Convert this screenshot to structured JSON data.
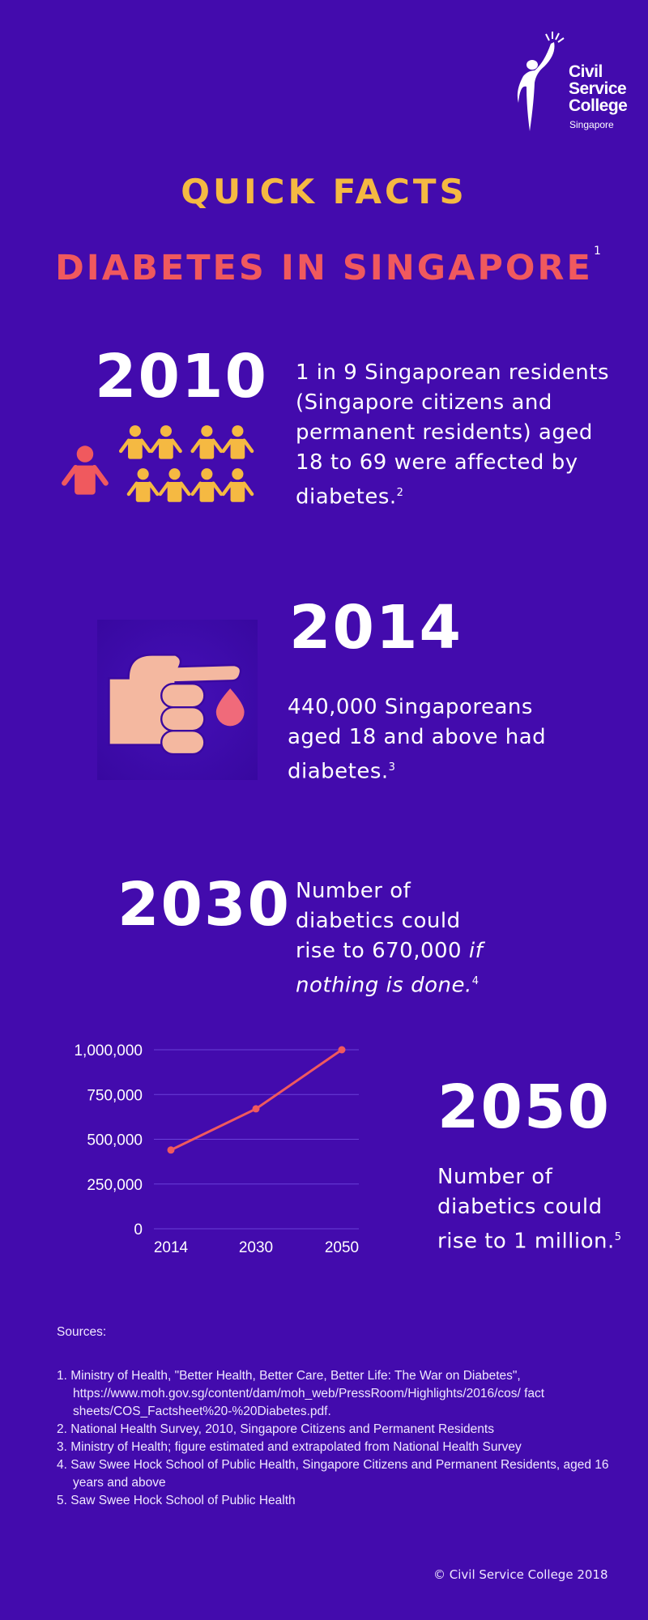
{
  "logo": {
    "line1": "Civil",
    "line2": "Service",
    "line3": "College",
    "sub": "Singapore"
  },
  "header": {
    "title": "QUICK FACTS",
    "subtitle": "DIABETES IN SINGAPORE",
    "subtitle_ref": "1"
  },
  "facts": [
    {
      "year": "2010",
      "text": "1 in 9 Singaporean residents (Singapore citizens and permanent residents) aged 18 to 69 were affected by diabetes.",
      "ref": "2"
    },
    {
      "year": "2014",
      "text": "440,000 Singaporeans aged 18 and above had diabetes.",
      "ref": "3"
    },
    {
      "year": "2030",
      "text": "Number of diabetics could rise to 670,000 ",
      "text_italic": "if nothing is done.",
      "ref": "4"
    },
    {
      "year": "2050",
      "text": "Number of diabetics could rise to 1 million.",
      "ref": "5"
    }
  ],
  "colors": {
    "background": "#430bad",
    "accent_yellow": "#f5b942",
    "accent_red": "#f0595e",
    "hand": "#f4b8a0"
  },
  "chart_data": {
    "type": "line",
    "categories": [
      "2014",
      "2030",
      "2050"
    ],
    "values": [
      440000,
      670000,
      1000000
    ],
    "ylim": [
      0,
      1000000
    ],
    "yticks": [
      0,
      250000,
      500000,
      750000,
      1000000
    ],
    "ytick_labels": [
      "0",
      "250,000",
      "500,000",
      "750,000",
      "1,000,000"
    ],
    "grid": true,
    "line_color": "#f0595e"
  },
  "sources": {
    "heading": "Sources:",
    "items": [
      "1. Ministry of Health, \"Better Health, Better Care, Better Life: The War on Diabetes\", https://www.moh.gov.sg/content/dam/moh_web/PressRoom/Highlights/2016/cos/ fact sheets/COS_Factsheet%20-%20Diabetes.pdf.",
      "2. National Health Survey, 2010, Singapore Citizens and Permanent Residents",
      "3. Ministry of Health; figure estimated and extrapolated from National Health Survey",
      "4. Saw Swee Hock School of Public Health, Singapore Citizens and Permanent Residents, aged 16 years and above",
      "5. Saw Swee Hock School of Public Health"
    ]
  },
  "footer": {
    "copyright": "© Civil Service College 2018"
  }
}
